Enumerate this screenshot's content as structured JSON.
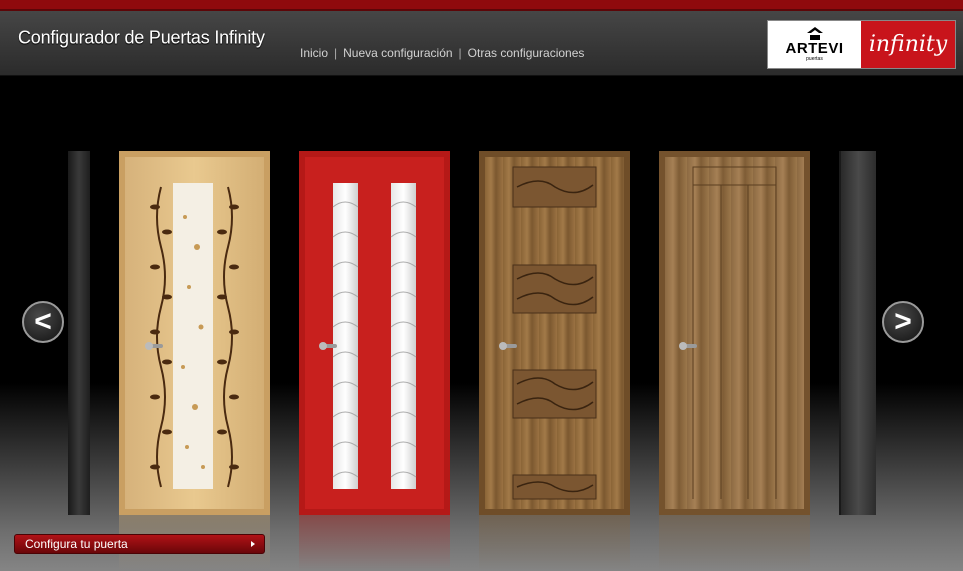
{
  "header": {
    "title": "Configurador de Puertas Infinity",
    "nav": [
      "Inicio",
      "Nueva configuración",
      "Otras configuraciones"
    ],
    "nav_separator": "|",
    "logo": {
      "brand": "ARTEVI",
      "brand_sub": "puertas",
      "product": "infinity"
    }
  },
  "carousel": {
    "prev_label": "<",
    "next_label": ">",
    "doors": [
      {
        "name": "door-partial-left",
        "finish": "dark grey"
      },
      {
        "name": "door-maple-glass-vines",
        "finish": "maple with glass and vine decoration"
      },
      {
        "name": "door-red-wave-glass",
        "finish": "red lacquer with wave glass"
      },
      {
        "name": "door-walnut-carved-panels",
        "finish": "walnut with carved leaf panels"
      },
      {
        "name": "door-walnut-plain",
        "finish": "walnut vertical planks"
      },
      {
        "name": "door-partial-right",
        "finish": "dark grey"
      }
    ]
  },
  "cta": {
    "label": "Configura tu puerta"
  },
  "colors": {
    "accent": "#b11217",
    "header_bg": "#3a3a3a",
    "stage_bg": "#000000"
  }
}
